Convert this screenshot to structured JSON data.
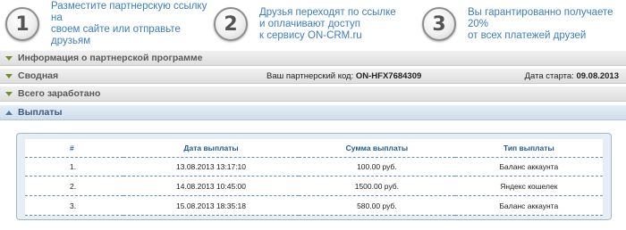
{
  "steps": [
    {
      "number": "1",
      "text_lines": [
        "Разместите партнерскую ссылку на",
        "своем сайте или отправьте друзьям"
      ]
    },
    {
      "number": "2",
      "text_lines": [
        "Друзья переходят по ссылке",
        "и оплачивают доступ",
        "к сервису ON-CRM.ru"
      ]
    },
    {
      "number": "3",
      "text_lines": [
        "Вы гарантированно получаете 20%",
        "от всех платежей друзей"
      ]
    }
  ],
  "sections": {
    "info": "Информация о партнерской программе",
    "summary": "Сводная",
    "partner_code_label": "Ваш партнерский код:",
    "partner_code": "ON-HFX7684309",
    "start_label": "Дата старта:",
    "start_date": "09.08.2013",
    "earned": "Всего заработано",
    "payouts": "Выплаты"
  },
  "payouts_table": {
    "headers": [
      "#",
      "Дата выплаты",
      "Сумма выплаты",
      "Тип выплаты"
    ],
    "rows": [
      {
        "num": "1.",
        "date": "13.08.2013 13:17:10",
        "amount": "100.00 руб.",
        "type": "Баланс аккаунта"
      },
      {
        "num": "2.",
        "date": "14.08.2013 10:45:00",
        "amount": "1500.00 руб.",
        "type": "Яндекс кошелек"
      },
      {
        "num": "3.",
        "date": "15.08.2013 18:35:18",
        "amount": "580.00 руб.",
        "type": "Баланс аккаунта"
      }
    ]
  },
  "colors": {
    "step_text": "#3d7ec0",
    "accent_green": "#6f8f2a",
    "table_header": "#1f5a8f"
  },
  "icons": {
    "collapsed": "triangle-down-icon",
    "expanded": "triangle-up-icon"
  }
}
